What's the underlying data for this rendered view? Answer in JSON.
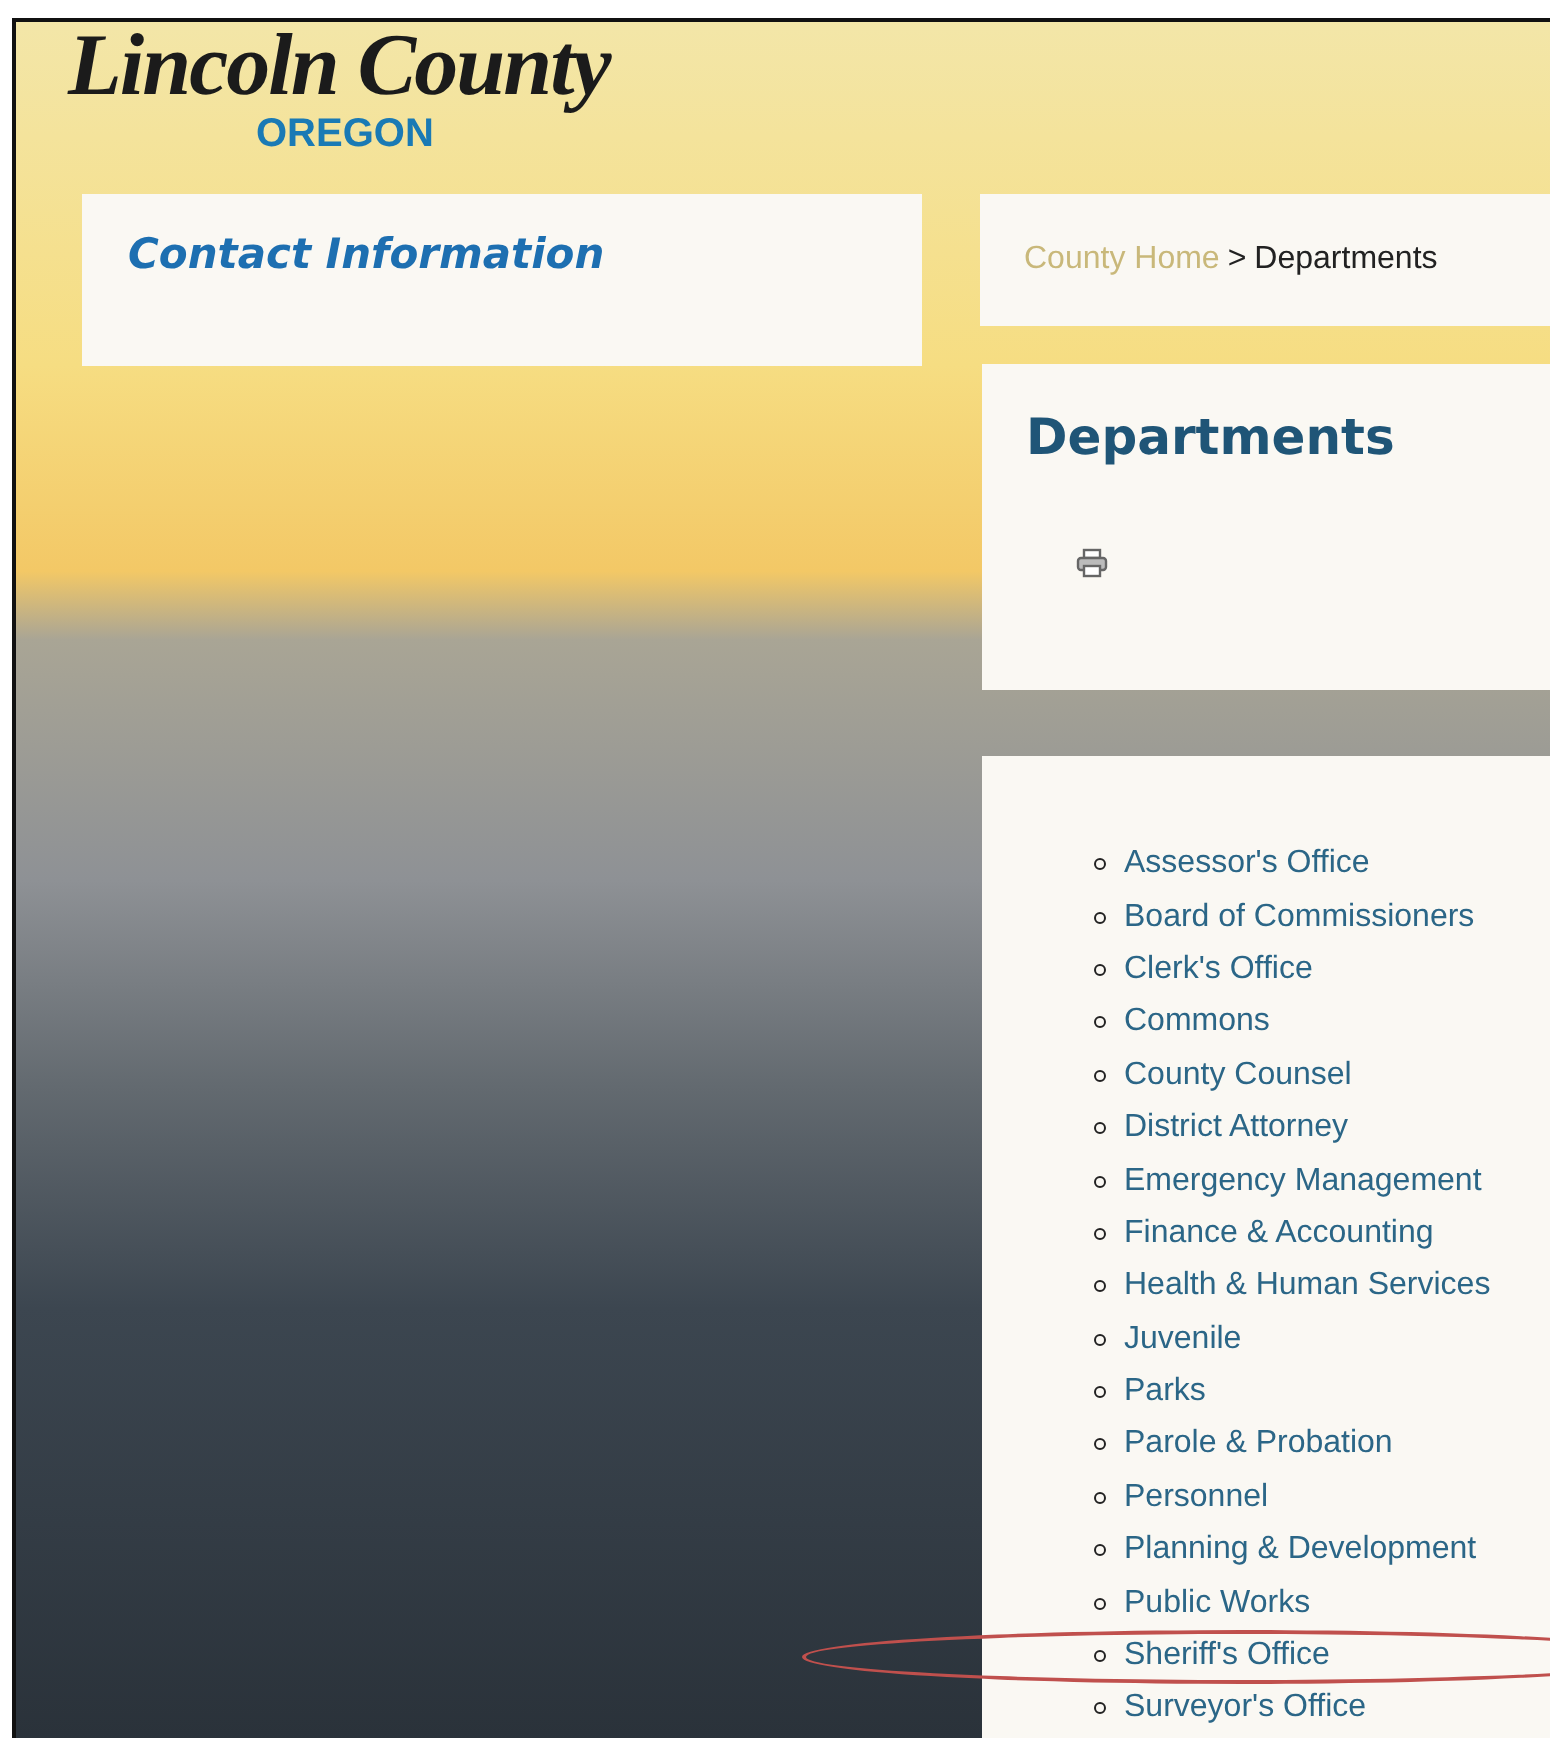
{
  "logo": {
    "title": "Lincoln County",
    "subtitle": "OREGON"
  },
  "contact": {
    "title": "Contact Information"
  },
  "breadcrumb": {
    "home": "County Home",
    "separator": ">",
    "current": "Departments"
  },
  "page": {
    "title": "Departments"
  },
  "departments": [
    {
      "label": "Assessor's Office",
      "circled": false
    },
    {
      "label": "Board of Commissioners",
      "circled": false
    },
    {
      "label": "Clerk's Office",
      "circled": false
    },
    {
      "label": "Commons",
      "circled": false
    },
    {
      "label": "County Counsel",
      "circled": false
    },
    {
      "label": "District Attorney",
      "circled": false
    },
    {
      "label": "Emergency Management",
      "circled": false
    },
    {
      "label": "Finance & Accounting",
      "circled": false
    },
    {
      "label": "Health & Human Services",
      "circled": false
    },
    {
      "label": "Juvenile",
      "circled": false
    },
    {
      "label": "Parks",
      "circled": false
    },
    {
      "label": "Parole & Probation",
      "circled": false
    },
    {
      "label": "Personnel",
      "circled": false
    },
    {
      "label": "Planning & Development",
      "circled": false
    },
    {
      "label": "Public Works",
      "circled": false
    },
    {
      "label": "Sheriff's Office",
      "circled": true
    },
    {
      "label": "Surveyor's Office",
      "circled": false
    }
  ]
}
